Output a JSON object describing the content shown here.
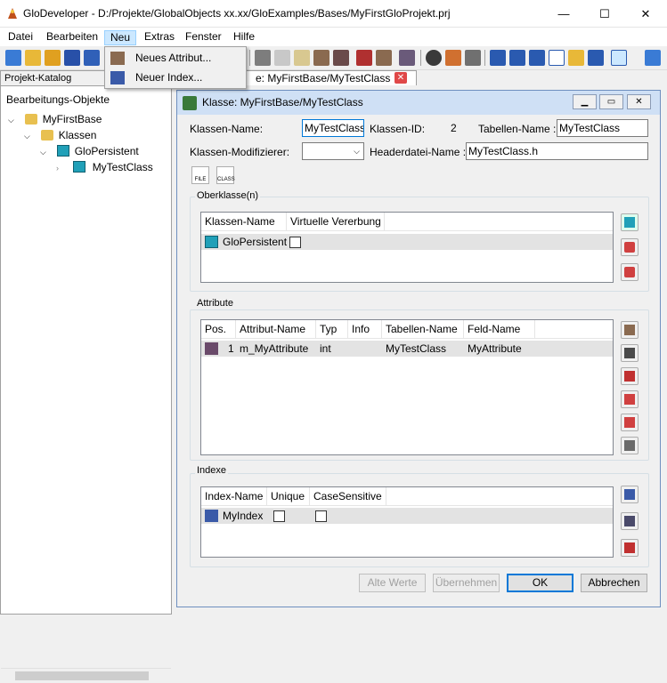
{
  "window": {
    "title": "GloDeveloper - D:/Projekte/GlobalObjects xx.xx/GloExamples/Bases/MyFirstGloProjekt.prj",
    "minimize": "—",
    "maximize": "☐",
    "close": "✕"
  },
  "menubar": {
    "items": [
      "Datei",
      "Bearbeiten",
      "Neu",
      "Extras",
      "Fenster",
      "Hilfe"
    ]
  },
  "neu_menu": {
    "items": [
      {
        "label": "Neues Attribut...",
        "icon": "attribute-icon"
      },
      {
        "label": "Neuer Index...",
        "icon": "index-icon"
      }
    ]
  },
  "left_panel": {
    "tab": "Projekt-Katalog",
    "heading": "Bearbeitungs-Objekte",
    "tree": [
      {
        "label": "MyFirstBase",
        "level": 1,
        "icon": "database-icon"
      },
      {
        "label": "Klassen",
        "level": 2,
        "icon": "folder-icon"
      },
      {
        "label": "GloPersistent",
        "level": 3,
        "icon": "class-icon"
      },
      {
        "label": "MyTestClass",
        "level": 4,
        "icon": "class-icon"
      }
    ]
  },
  "doc_tab": {
    "label": "e: MyFirstBase/MyTestClass"
  },
  "dialog": {
    "title": "Klasse: MyFirstBase/MyTestClass",
    "fields": {
      "klassen_name_label": "Klassen-Name:",
      "klassen_name": "MyTestClass",
      "klassen_id_label": "Klassen-ID:",
      "klassen_id": "2",
      "tabellen_name_label": "Tabellen-Name :",
      "tabellen_name": "MyTestClass",
      "modifizierer_label": "Klassen-Modifizierer:",
      "modifizierer": "",
      "headerdatei_label": "Headerdatei-Name :",
      "headerdatei": "MyTestClass.h"
    },
    "icon_labels": {
      "file": "FILE",
      "class": "CLASS"
    },
    "oberklasse": {
      "label": "Oberklasse(n)",
      "columns": [
        "Klassen-Name",
        "Virtuelle Vererbung"
      ],
      "rows": [
        {
          "name": "GloPersistent",
          "virtual": false
        }
      ]
    },
    "attribute": {
      "label": "Attribute",
      "columns": [
        "Pos.",
        "Attribut-Name",
        "Typ",
        "Info",
        "Tabellen-Name",
        "Feld-Name"
      ],
      "rows": [
        {
          "pos": "1",
          "name": "m_MyAttribute",
          "typ": "int",
          "info": "",
          "tabelle": "MyTestClass",
          "feld": "MyAttribute"
        }
      ]
    },
    "indexe": {
      "label": "Indexe",
      "columns": [
        "Index-Name",
        "Unique",
        "CaseSensitive"
      ],
      "rows": [
        {
          "name": "MyIndex",
          "unique": false,
          "case_sensitive": false
        }
      ]
    },
    "buttons": {
      "alte_werte": "Alte Werte",
      "uebernehmen": "Übernehmen",
      "ok": "OK",
      "abbrechen": "Abbrechen"
    }
  }
}
